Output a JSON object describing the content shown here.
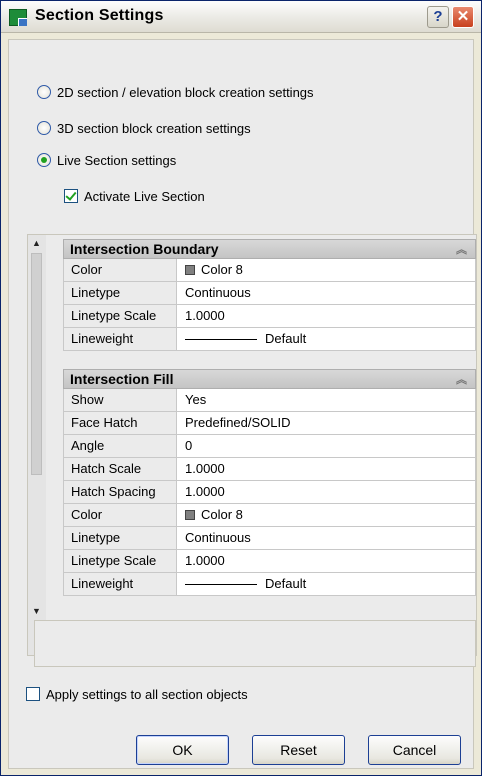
{
  "window": {
    "title": "Section Settings",
    "help_glyph": "?",
    "close_glyph": "✕"
  },
  "options": {
    "radio_2d_label": "2D section / elevation block creation settings",
    "radio_3d_label": "3D section block creation settings",
    "radio_live_label": "Live Section settings",
    "selected": "Live Section settings",
    "activate_live_label": "Activate Live Section",
    "activate_live_checked": true
  },
  "palette": {
    "boundary": {
      "header": "Intersection Boundary",
      "rows": [
        {
          "key": "Color",
          "value": "Color 8",
          "swatch": "#808080"
        },
        {
          "key": "Linetype",
          "value": "Continuous"
        },
        {
          "key": "Linetype Scale",
          "value": "1.0000"
        },
        {
          "key": "Lineweight",
          "value": "Default"
        }
      ]
    },
    "fill": {
      "header": "Intersection Fill",
      "rows": [
        {
          "key": "Show",
          "value": "Yes"
        },
        {
          "key": "Face Hatch",
          "value": "Predefined/SOLID"
        },
        {
          "key": "Angle",
          "value": "0"
        },
        {
          "key": "Hatch Scale",
          "value": "1.0000"
        },
        {
          "key": "Hatch Spacing",
          "value": "1.0000"
        },
        {
          "key": "Color",
          "value": "Color 8",
          "swatch": "#808080"
        },
        {
          "key": "Linetype",
          "value": "Continuous"
        },
        {
          "key": "Linetype Scale",
          "value": "1.0000"
        },
        {
          "key": "Lineweight",
          "value": "Default"
        }
      ]
    },
    "scroll_up_icon": "scroll-up-icon",
    "scroll_down_icon": "scroll-down-icon"
  },
  "apply_all": {
    "label": "Apply settings to all section objects",
    "checked": false
  },
  "buttons": {
    "ok": "OK",
    "reset": "Reset",
    "cancel": "Cancel"
  },
  "colors": {
    "title_accent": "#0a246a",
    "check_green": "#21a121",
    "close_red": "#c8401e"
  }
}
